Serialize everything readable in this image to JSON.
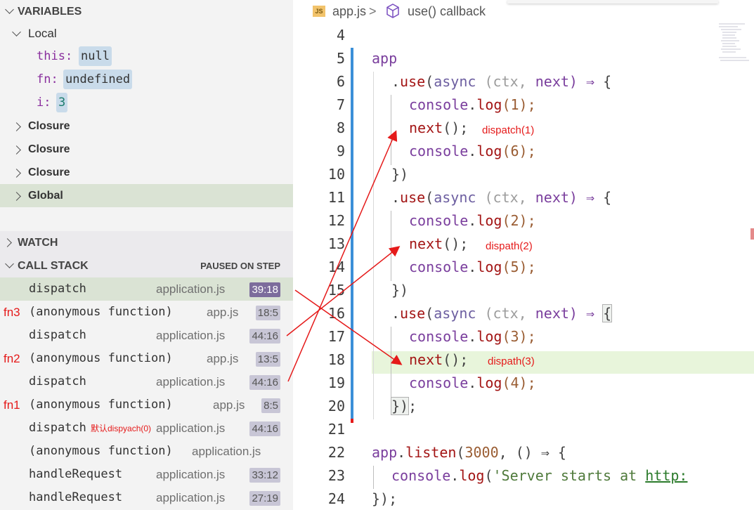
{
  "variables": {
    "header": "VARIABLES",
    "local_label": "Local",
    "locals": [
      {
        "name": "this:",
        "value": "null"
      },
      {
        "name": "fn:",
        "value": "undefined"
      },
      {
        "name": "i:",
        "value": "3"
      }
    ],
    "scopes": [
      "Closure",
      "Closure",
      "Closure",
      "Global"
    ]
  },
  "watch": {
    "header": "WATCH"
  },
  "call_stack": {
    "header": "CALL STACK",
    "status": "PAUSED ON STEP",
    "frames": [
      {
        "label": "",
        "name": "dispatch",
        "note": "",
        "file": "application.js",
        "pos": "39:18"
      },
      {
        "label": "fn3",
        "name": "(anonymous function)",
        "note": "",
        "file": "app.js",
        "pos": "18:5"
      },
      {
        "label": "",
        "name": "dispatch",
        "note": "",
        "file": "application.js",
        "pos": "44:16"
      },
      {
        "label": "fn2",
        "name": "(anonymous function)",
        "note": "",
        "file": "app.js",
        "pos": "13:5"
      },
      {
        "label": "",
        "name": "dispatch",
        "note": "",
        "file": "application.js",
        "pos": "44:16"
      },
      {
        "label": "fn1",
        "name": "(anonymous function)",
        "note": "",
        "file": "app.js",
        "pos": "8:5"
      },
      {
        "label": "",
        "name": "dispatch",
        "note": "默认dispyach(0)",
        "file": "application.js",
        "pos": "44:16"
      },
      {
        "label": "",
        "name": "(anonymous function)",
        "note": "",
        "file": "application.js",
        "pos": ""
      },
      {
        "label": "",
        "name": "handleRequest",
        "note": "",
        "file": "application.js",
        "pos": "33:12"
      },
      {
        "label": "",
        "name": "handleRequest",
        "note": "",
        "file": "application.js",
        "pos": "27:19"
      }
    ]
  },
  "editor": {
    "breadcrumb_file": "app.js",
    "breadcrumb_sep": ">",
    "breadcrumb_symbol": "use() callback",
    "file_icon_text": "JS",
    "line_numbers": [
      "4",
      "5",
      "6",
      "7",
      "8",
      "9",
      "10",
      "11",
      "12",
      "13",
      "14",
      "15",
      "16",
      "17",
      "18",
      "19",
      "20",
      "21",
      "22",
      "23",
      "24"
    ],
    "lines": {
      "l5": "app",
      "l6_a": ".",
      "l6_use": "use",
      "l6_b": "(",
      "l6_async": "async",
      "l6_ctx": "(ctx,",
      "l6_next": "next)",
      "l6_arrow": "⇒",
      "l6_brace": "{",
      "console": "console",
      "dot": ".",
      "log": "log",
      "next_call": "next",
      "paren_semi": "();",
      "l7_arg": "(1);",
      "l9_arg": "(6);",
      "l12_arg": "(2);",
      "l14_arg": "(5);",
      "l17_arg": "(3);",
      "l19_arg": "(4);",
      "close": "})",
      "close_semi": "});",
      "l20_close": "})",
      "l20_semi": ";",
      "l22_app": "app",
      "l22_listen": "listen",
      "l22_port": "3000",
      "l22_rest": ", () ⇒ {",
      "l22_open": "(",
      "l23_str": "'Server starts at ",
      "l23_url": "http:",
      "l23_open": "("
    },
    "annotations": [
      "dispatch(1)",
      "dispath(2)",
      "dispath(3)"
    ]
  },
  "colors": {
    "accent_blue": "#3a8fd8",
    "annotation_red": "#e51a1a",
    "current_line": "#e8f5db",
    "selected_row": "#dae3d4"
  }
}
